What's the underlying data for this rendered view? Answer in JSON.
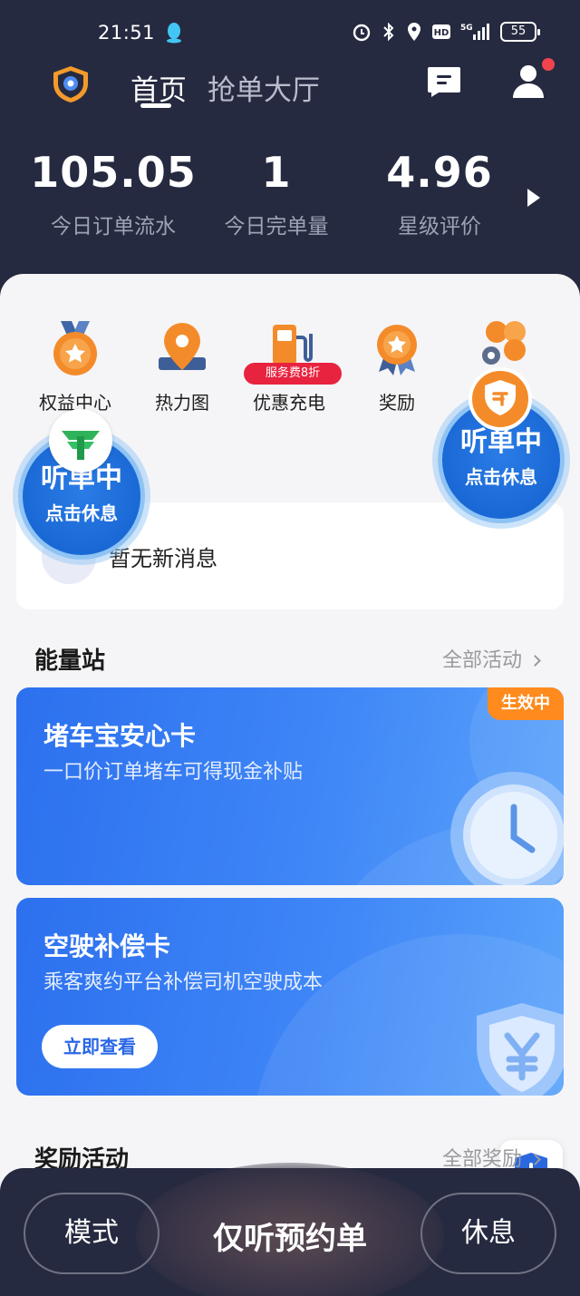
{
  "status_bar": {
    "time": "21:51",
    "network": "5G",
    "battery": "55",
    "icons": [
      "qq-icon",
      "alarm-icon",
      "bluetooth-icon",
      "location-icon",
      "hd-icon",
      "signal-icon",
      "battery-icon"
    ]
  },
  "header": {
    "tabs": [
      {
        "label": "首页",
        "active": true
      },
      {
        "label": "抢单大厅",
        "active": false
      }
    ],
    "icons": [
      "app-logo-icon",
      "message-icon",
      "user-icon"
    ],
    "has_notification_dot": true
  },
  "stats": [
    {
      "value": "105.05",
      "label": "今日订单流水"
    },
    {
      "value": "1",
      "label": "今日完单量"
    },
    {
      "value": "4.96",
      "label": "星级评价"
    }
  ],
  "quick_actions": [
    {
      "label": "权益中心",
      "icon": "medal-icon"
    },
    {
      "label": "热力图",
      "icon": "location-pin-icon"
    },
    {
      "label": "优惠充电",
      "icon": "charger-icon",
      "badge": "服务费8折"
    },
    {
      "label": "奖励",
      "icon": "award-icon"
    },
    {
      "label": "",
      "icon": "more-icon"
    }
  ],
  "messages": {
    "empty_text": "暂无新消息"
  },
  "listening_bubbles": [
    {
      "status": "听单中",
      "action": "点击休息"
    },
    {
      "status": "听单中",
      "action": "点击休息"
    }
  ],
  "energy_station": {
    "title": "能量站",
    "more": "全部活动",
    "cards": [
      {
        "title": "堵车宝安心卡",
        "subtitle": "一口价订单堵车可得现金补贴",
        "badge": "生效中"
      },
      {
        "title": "空驶补偿卡",
        "subtitle": "乘客爽约平台补偿司机空驶成本",
        "button": "立即查看"
      }
    ]
  },
  "rewards": {
    "title": "奖励活动",
    "more": "全部奖励"
  },
  "bottom_bar": {
    "mode": "模式",
    "center": "仅听预约单",
    "rest": "休息"
  },
  "colors": {
    "header_bg": "#262a40",
    "accent_blue": "#2c70ee",
    "badge_orange": "#ff8a1d",
    "badge_red": "#e8233f"
  }
}
